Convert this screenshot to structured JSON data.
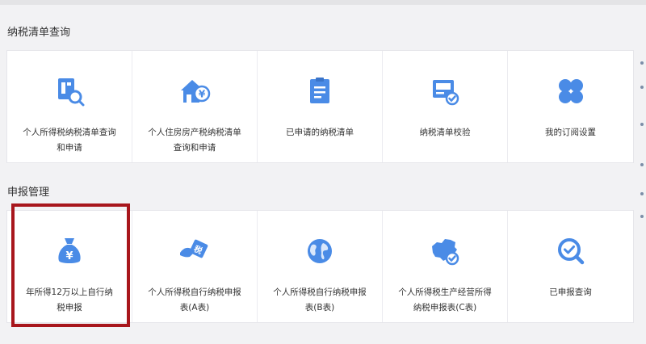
{
  "sections": [
    {
      "title": "纳税清单查询",
      "cards": [
        {
          "label": "个人所得税纳税清单查询和申请",
          "icon": "tax-list-search-icon"
        },
        {
          "label": "个人住房房产税纳税清单查询和申请",
          "icon": "house-tax-icon"
        },
        {
          "label": "已申请的纳税清单",
          "icon": "document-list-icon"
        },
        {
          "label": "纳税清单校验",
          "icon": "verify-screen-icon"
        },
        {
          "label": "我的订阅设置",
          "icon": "clover-icon"
        }
      ]
    },
    {
      "title": "申报管理",
      "cards": [
        {
          "label": "年所得12万以上自行纳税申报",
          "icon": "money-bag-icon"
        },
        {
          "label": "个人所得税自行纳税申报表(A表)",
          "icon": "hand-tax-tag-icon"
        },
        {
          "label": "个人所得税自行纳税申报表(B表)",
          "icon": "globe-icon"
        },
        {
          "label": "个人所得税生产经营所得纳税申报表(C表)",
          "icon": "china-map-check-icon"
        },
        {
          "label": "已申报查询",
          "icon": "magnifier-check-icon"
        }
      ]
    }
  ],
  "colors": {
    "accent": "#4a8be6",
    "highlight": "#a8161c"
  }
}
